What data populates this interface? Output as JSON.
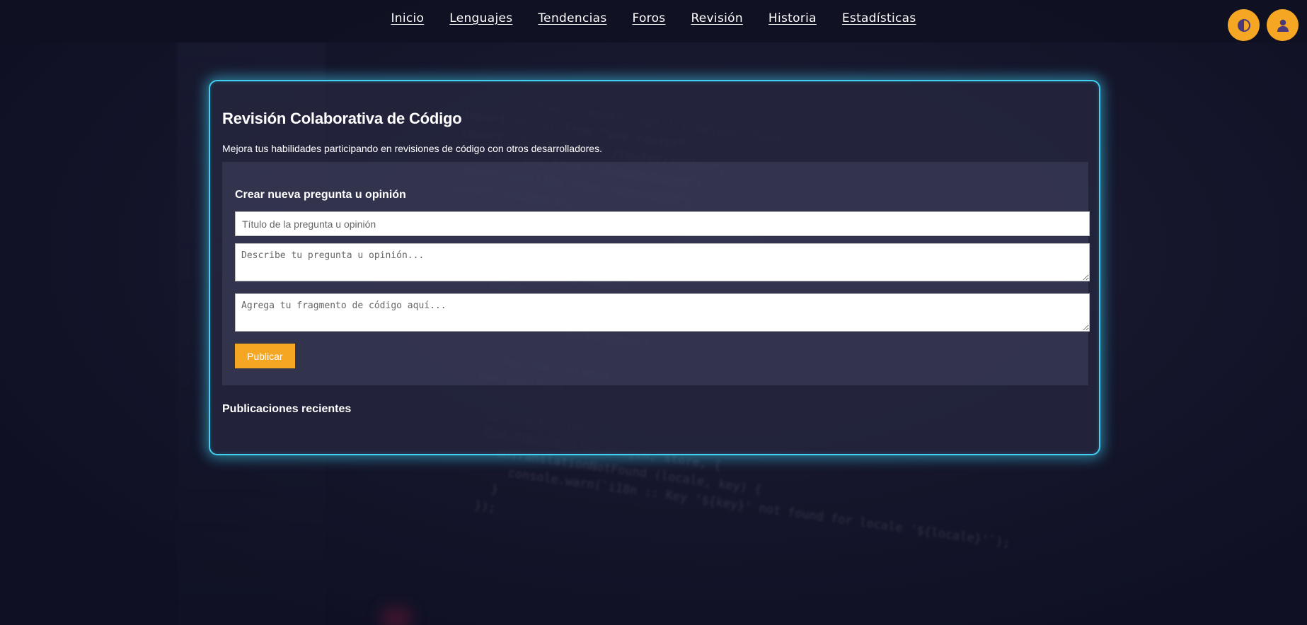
{
  "nav": {
    "items": [
      {
        "label": "Inicio"
      },
      {
        "label": "Lenguajes"
      },
      {
        "label": "Tendencias"
      },
      {
        "label": "Foros"
      },
      {
        "label": "Revisión"
      },
      {
        "label": "Historia"
      },
      {
        "label": "Estadísticas"
      }
    ],
    "theme_icon": "contrast-icon",
    "user_icon": "user-icon"
  },
  "page": {
    "title": "Revisión Colaborativa de Código",
    "subtitle": "Mejora tus habilidades participando en revisiones de código con otros desarrolladores."
  },
  "form": {
    "heading": "Crear nueva pregunta u opinión",
    "title_placeholder": "Título de la pregunta u opinión",
    "description_placeholder": "Describe tu pregunta u opinión...",
    "code_placeholder": "Agrega tu fragmento de código aquí...",
    "submit_label": "Publicar"
  },
  "recent": {
    "heading": "Publicaciones recientes"
  },
  "colors": {
    "accent": "#f5a623",
    "card_border": "#3fd0f2"
  }
}
